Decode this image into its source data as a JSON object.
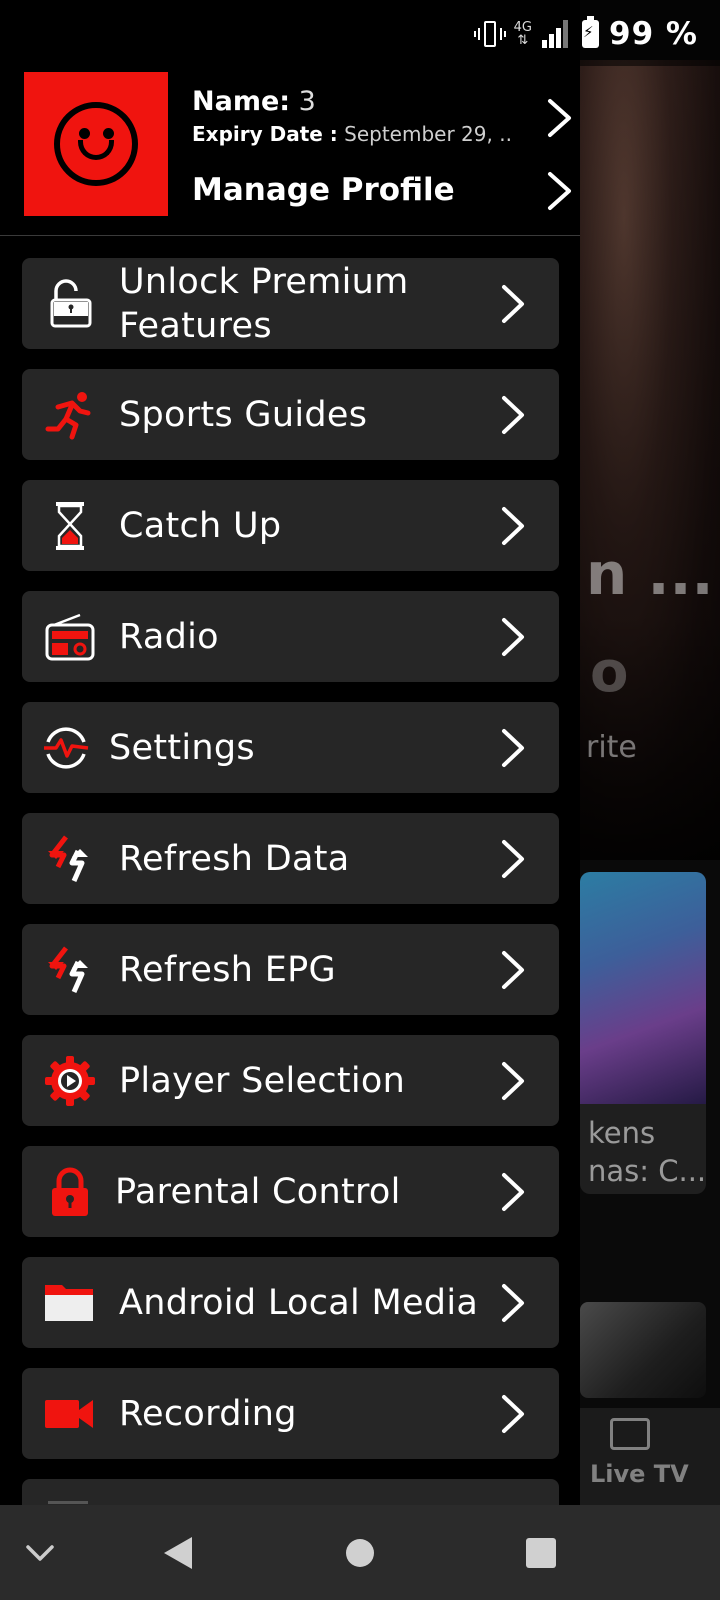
{
  "status_bar": {
    "network": "4G",
    "battery": "99 %"
  },
  "profile": {
    "name_label": "Name:",
    "name_value": "3",
    "expiry_label": "Expiry Date :",
    "expiry_value": "September 29, ..",
    "manage_label": "Manage Profile"
  },
  "menu": {
    "items": [
      {
        "label": "Unlock Premium Features",
        "icon": "unlock-icon"
      },
      {
        "label": "Sports Guides",
        "icon": "runner-icon"
      },
      {
        "label": "Catch Up",
        "icon": "hourglass-icon"
      },
      {
        "label": "Radio",
        "icon": "radio-icon"
      },
      {
        "label": "Settings",
        "icon": "settings-pulse-icon"
      },
      {
        "label": "Refresh Data",
        "icon": "refresh-icon"
      },
      {
        "label": "Refresh EPG",
        "icon": "refresh-icon"
      },
      {
        "label": "Player Selection",
        "icon": "gear-play-icon"
      },
      {
        "label": "Parental Control",
        "icon": "lock-icon"
      },
      {
        "label": "Android Local Media",
        "icon": "folder-icon"
      },
      {
        "label": "Recording",
        "icon": "video-camera-icon"
      }
    ]
  },
  "background": {
    "hero_title": "n ...",
    "favorite_text": "rite",
    "card_text_line1": "kens",
    "card_text_line2": "nas: C...",
    "live_tv_label": "Live TV"
  },
  "colors": {
    "accent": "#f0140f",
    "drawer_bg": "#000000",
    "item_bg": "#262626",
    "nav_bg": "#2b2b2b"
  }
}
